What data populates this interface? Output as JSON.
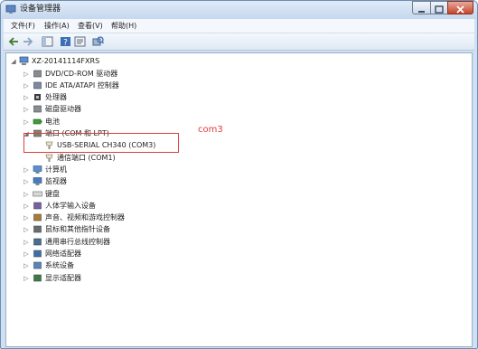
{
  "window": {
    "title": "设备管理器"
  },
  "menubar": {
    "items": [
      "文件(F)",
      "操作(A)",
      "查看(V)",
      "帮助(H)"
    ]
  },
  "toolbar": {
    "buttons": [
      "back-icon",
      "forward-icon",
      "show-hide-console-tree-icon",
      "help-icon",
      "properties-icon",
      "scan-hardware-icon"
    ]
  },
  "tree": {
    "root": "XZ-20141114FXRS",
    "items": [
      {
        "label": "DVD/CD-ROM 驱动器",
        "icon": "dvd-drive-icon",
        "expander": "collapsed"
      },
      {
        "label": "IDE ATA/ATAPI 控制器",
        "icon": "ide-controller-icon",
        "expander": "collapsed"
      },
      {
        "label": "处理器",
        "icon": "processor-icon",
        "expander": "collapsed"
      },
      {
        "label": "磁盘驱动器",
        "icon": "disk-drive-icon",
        "expander": "collapsed"
      },
      {
        "label": "电池",
        "icon": "battery-icon",
        "expander": "collapsed"
      },
      {
        "label": "端口 (COM 和 LPT)",
        "icon": "port-icon",
        "expander": "expanded"
      },
      {
        "label": "USB-SERIAL CH340 (COM3)",
        "icon": "serial-port-icon",
        "expander": "none"
      },
      {
        "label": "通信端口 (COM1)",
        "icon": "serial-port-icon",
        "expander": "none"
      },
      {
        "label": "计算机",
        "icon": "computer-icon",
        "expander": "collapsed"
      },
      {
        "label": "监视器",
        "icon": "monitor-icon",
        "expander": "collapsed"
      },
      {
        "label": "键盘",
        "icon": "keyboard-icon",
        "expander": "collapsed"
      },
      {
        "label": "人体学输入设备",
        "icon": "hid-icon",
        "expander": "collapsed"
      },
      {
        "label": "声音、视频和游戏控制器",
        "icon": "sound-icon",
        "expander": "collapsed"
      },
      {
        "label": "鼠标和其他指针设备",
        "icon": "mouse-icon",
        "expander": "collapsed"
      },
      {
        "label": "通用串行总线控制器",
        "icon": "usb-controller-icon",
        "expander": "collapsed"
      },
      {
        "label": "网络适配器",
        "icon": "network-adapter-icon",
        "expander": "collapsed"
      },
      {
        "label": "系统设备",
        "icon": "system-device-icon",
        "expander": "collapsed"
      },
      {
        "label": "显示适配器",
        "icon": "display-adapter-icon",
        "expander": "collapsed"
      }
    ]
  },
  "annotation": {
    "text": "com3",
    "color": "#e23c3c"
  },
  "colors": {
    "frame": "#cfe0f3",
    "highlight": "#e23c3c"
  }
}
